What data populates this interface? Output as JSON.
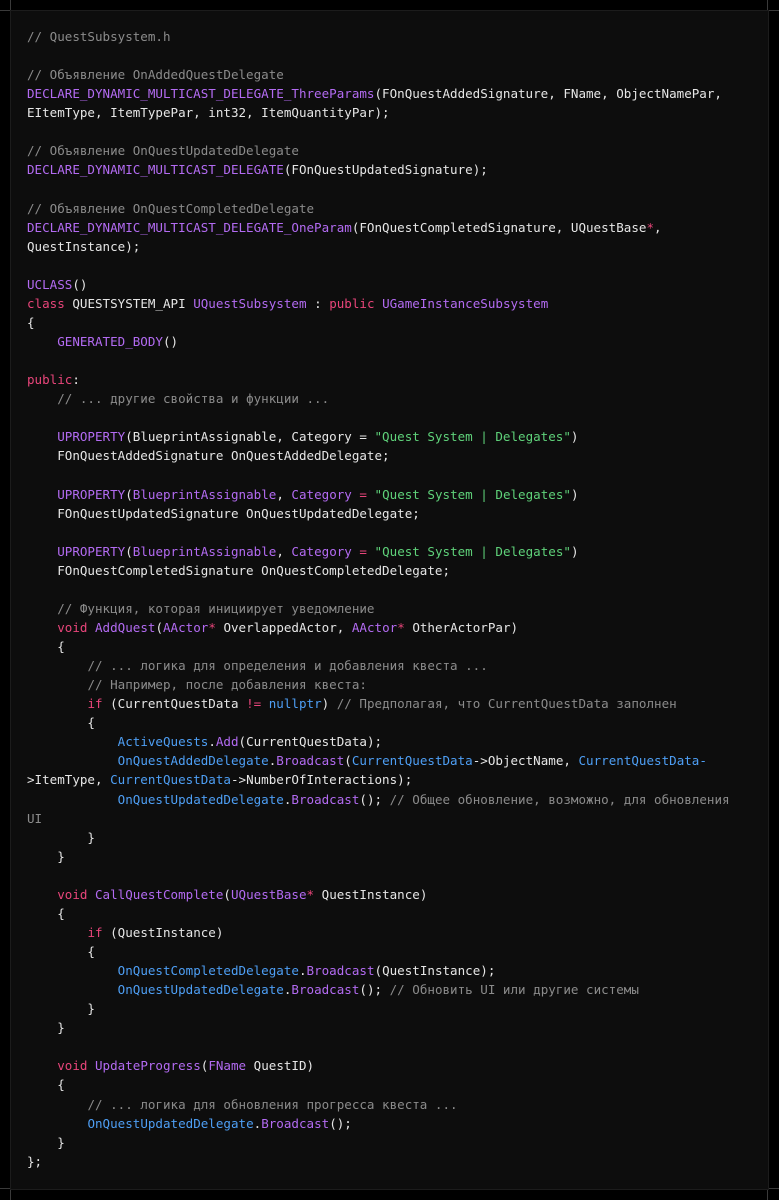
{
  "code_lines": [
    [
      {
        "t": "// QuestSubsystem.h",
        "c": "comment"
      }
    ],
    [],
    [
      {
        "t": "// Объявление OnAddedQuestDelegate",
        "c": "comment"
      }
    ],
    [
      {
        "t": "DECLARE_DYNAMIC_MULTICAST_DELEGATE_ThreeParams",
        "c": "macro"
      },
      {
        "t": "(FOnQuestAddedSignature, FName, ObjectNamePar,",
        "c": "plain"
      }
    ],
    [
      {
        "t": "EItemType, ItemTypePar, int32, ItemQuantityPar);",
        "c": "plain"
      }
    ],
    [],
    [
      {
        "t": "// Объявление OnQuestUpdatedDelegate",
        "c": "comment"
      }
    ],
    [
      {
        "t": "DECLARE_DYNAMIC_MULTICAST_DELEGATE",
        "c": "macro"
      },
      {
        "t": "(FOnQuestUpdatedSignature);",
        "c": "plain"
      }
    ],
    [],
    [
      {
        "t": "// Объявление OnQuestCompletedDelegate",
        "c": "comment"
      }
    ],
    [
      {
        "t": "DECLARE_DYNAMIC_MULTICAST_DELEGATE_OneParam",
        "c": "macro"
      },
      {
        "t": "(FOnQuestCompletedSignature, UQuestBase",
        "c": "plain"
      },
      {
        "t": "*",
        "c": "op"
      },
      {
        "t": ",",
        "c": "plain"
      }
    ],
    [
      {
        "t": "QuestInstance);",
        "c": "plain"
      }
    ],
    [],
    [
      {
        "t": "UCLASS",
        "c": "macro"
      },
      {
        "t": "()",
        "c": "plain"
      }
    ],
    [
      {
        "t": "class",
        "c": "keyword"
      },
      {
        "t": " QUESTSYSTEM_API ",
        "c": "plain"
      },
      {
        "t": "UQuestSubsystem",
        "c": "type"
      },
      {
        "t": " : ",
        "c": "plain"
      },
      {
        "t": "public",
        "c": "keyword"
      },
      {
        "t": " ",
        "c": "plain"
      },
      {
        "t": "UGameInstanceSubsystem",
        "c": "type"
      }
    ],
    [
      {
        "t": "{",
        "c": "plain"
      }
    ],
    [
      {
        "t": "    ",
        "c": "plain"
      },
      {
        "t": "GENERATED_BODY",
        "c": "macro"
      },
      {
        "t": "()",
        "c": "plain"
      }
    ],
    [],
    [
      {
        "t": "public",
        "c": "keyword"
      },
      {
        "t": ":",
        "c": "plain"
      }
    ],
    [
      {
        "t": "    ",
        "c": "plain"
      },
      {
        "t": "// ... другие свойства и функции ...",
        "c": "comment"
      }
    ],
    [],
    [
      {
        "t": "    ",
        "c": "plain"
      },
      {
        "t": "UPROPERTY",
        "c": "macro"
      },
      {
        "t": "(BlueprintAssignable, Category = ",
        "c": "plain"
      },
      {
        "t": "\"Quest System | Delegates\"",
        "c": "string"
      },
      {
        "t": ")",
        "c": "plain"
      }
    ],
    [
      {
        "t": "    FOnQuestAddedSignature OnQuestAddedDelegate;",
        "c": "plain"
      }
    ],
    [],
    [
      {
        "t": "    ",
        "c": "plain"
      },
      {
        "t": "UPROPERTY",
        "c": "macro"
      },
      {
        "t": "(",
        "c": "plain"
      },
      {
        "t": "BlueprintAssignable",
        "c": "type"
      },
      {
        "t": ", ",
        "c": "plain"
      },
      {
        "t": "Category",
        "c": "type"
      },
      {
        "t": " = ",
        "c": "op"
      },
      {
        "t": "\"Quest System | Delegates\"",
        "c": "string"
      },
      {
        "t": ")",
        "c": "plain"
      }
    ],
    [
      {
        "t": "    FOnQuestUpdatedSignature OnQuestUpdatedDelegate;",
        "c": "plain"
      }
    ],
    [],
    [
      {
        "t": "    ",
        "c": "plain"
      },
      {
        "t": "UPROPERTY",
        "c": "macro"
      },
      {
        "t": "(",
        "c": "plain"
      },
      {
        "t": "BlueprintAssignable",
        "c": "type"
      },
      {
        "t": ", ",
        "c": "plain"
      },
      {
        "t": "Category",
        "c": "type"
      },
      {
        "t": " = ",
        "c": "op"
      },
      {
        "t": "\"Quest System | Delegates\"",
        "c": "string"
      },
      {
        "t": ")",
        "c": "plain"
      }
    ],
    [
      {
        "t": "    FOnQuestCompletedSignature OnQuestCompletedDelegate;",
        "c": "plain"
      }
    ],
    [],
    [
      {
        "t": "    ",
        "c": "plain"
      },
      {
        "t": "// Функция, которая инициирует уведомление",
        "c": "comment"
      }
    ],
    [
      {
        "t": "    ",
        "c": "plain"
      },
      {
        "t": "void",
        "c": "keyword"
      },
      {
        "t": " ",
        "c": "plain"
      },
      {
        "t": "AddQuest",
        "c": "type"
      },
      {
        "t": "(",
        "c": "plain"
      },
      {
        "t": "AActor",
        "c": "type"
      },
      {
        "t": "*",
        "c": "op"
      },
      {
        "t": " OverlappedActor, ",
        "c": "plain"
      },
      {
        "t": "AActor",
        "c": "type"
      },
      {
        "t": "*",
        "c": "op"
      },
      {
        "t": " OtherActorPar)",
        "c": "plain"
      }
    ],
    [
      {
        "t": "    {",
        "c": "plain"
      }
    ],
    [
      {
        "t": "        ",
        "c": "plain"
      },
      {
        "t": "// ... логика для определения и добавления квеста ...",
        "c": "comment"
      }
    ],
    [
      {
        "t": "        ",
        "c": "plain"
      },
      {
        "t": "// Например, после добавления квеста:",
        "c": "comment"
      }
    ],
    [
      {
        "t": "        ",
        "c": "plain"
      },
      {
        "t": "if",
        "c": "keyword"
      },
      {
        "t": " (CurrentQuestData ",
        "c": "plain"
      },
      {
        "t": "!=",
        "c": "op"
      },
      {
        "t": " ",
        "c": "plain"
      },
      {
        "t": "nullptr",
        "c": "member"
      },
      {
        "t": ") ",
        "c": "plain"
      },
      {
        "t": "// Предполагая, что CurrentQuestData заполнен",
        "c": "comment"
      }
    ],
    [
      {
        "t": "        {",
        "c": "plain"
      }
    ],
    [
      {
        "t": "            ",
        "c": "plain"
      },
      {
        "t": "ActiveQuests",
        "c": "member"
      },
      {
        "t": ".",
        "c": "plain"
      },
      {
        "t": "Add",
        "c": "type"
      },
      {
        "t": "(CurrentQuestData);",
        "c": "plain"
      }
    ],
    [
      {
        "t": "            ",
        "c": "plain"
      },
      {
        "t": "OnQuestAddedDelegate",
        "c": "member"
      },
      {
        "t": ".",
        "c": "plain"
      },
      {
        "t": "Broadcast",
        "c": "type"
      },
      {
        "t": "(",
        "c": "plain"
      },
      {
        "t": "CurrentQuestData",
        "c": "member"
      },
      {
        "t": "->ObjectName, ",
        "c": "plain"
      },
      {
        "t": "CurrentQuestData-",
        "c": "member"
      }
    ],
    [
      {
        "t": ">ItemType, ",
        "c": "plain"
      },
      {
        "t": "CurrentQuestData",
        "c": "member"
      },
      {
        "t": "->NumberOfInteractions);",
        "c": "plain"
      }
    ],
    [
      {
        "t": "            ",
        "c": "plain"
      },
      {
        "t": "OnQuestUpdatedDelegate",
        "c": "member"
      },
      {
        "t": ".",
        "c": "plain"
      },
      {
        "t": "Broadcast",
        "c": "type"
      },
      {
        "t": "(); ",
        "c": "plain"
      },
      {
        "t": "// Общее обновление, возможно, для обновления",
        "c": "comment"
      }
    ],
    [
      {
        "t": "UI",
        "c": "comment"
      }
    ],
    [
      {
        "t": "        }",
        "c": "plain"
      }
    ],
    [
      {
        "t": "    }",
        "c": "plain"
      }
    ],
    [],
    [
      {
        "t": "    ",
        "c": "plain"
      },
      {
        "t": "void",
        "c": "keyword"
      },
      {
        "t": " ",
        "c": "plain"
      },
      {
        "t": "CallQuestComplete",
        "c": "type"
      },
      {
        "t": "(",
        "c": "plain"
      },
      {
        "t": "UQuestBase",
        "c": "type"
      },
      {
        "t": "*",
        "c": "op"
      },
      {
        "t": " QuestInstance)",
        "c": "plain"
      }
    ],
    [
      {
        "t": "    {",
        "c": "plain"
      }
    ],
    [
      {
        "t": "        ",
        "c": "plain"
      },
      {
        "t": "if",
        "c": "keyword"
      },
      {
        "t": " (QuestInstance)",
        "c": "plain"
      }
    ],
    [
      {
        "t": "        {",
        "c": "plain"
      }
    ],
    [
      {
        "t": "            ",
        "c": "plain"
      },
      {
        "t": "OnQuestCompletedDelegate",
        "c": "member"
      },
      {
        "t": ".",
        "c": "plain"
      },
      {
        "t": "Broadcast",
        "c": "type"
      },
      {
        "t": "(QuestInstance);",
        "c": "plain"
      }
    ],
    [
      {
        "t": "            ",
        "c": "plain"
      },
      {
        "t": "OnQuestUpdatedDelegate",
        "c": "member"
      },
      {
        "t": ".",
        "c": "plain"
      },
      {
        "t": "Broadcast",
        "c": "type"
      },
      {
        "t": "(); ",
        "c": "plain"
      },
      {
        "t": "// Обновить UI или другие системы",
        "c": "comment"
      }
    ],
    [
      {
        "t": "        }",
        "c": "plain"
      }
    ],
    [
      {
        "t": "    }",
        "c": "plain"
      }
    ],
    [],
    [
      {
        "t": "    ",
        "c": "plain"
      },
      {
        "t": "void",
        "c": "keyword"
      },
      {
        "t": " ",
        "c": "plain"
      },
      {
        "t": "UpdateProgress",
        "c": "type"
      },
      {
        "t": "(",
        "c": "plain"
      },
      {
        "t": "FName",
        "c": "type"
      },
      {
        "t": " QuestID)",
        "c": "plain"
      }
    ],
    [
      {
        "t": "    {",
        "c": "plain"
      }
    ],
    [
      {
        "t": "        ",
        "c": "plain"
      },
      {
        "t": "// ... логика для обновления прогресса квеста ...",
        "c": "comment"
      }
    ],
    [
      {
        "t": "        ",
        "c": "plain"
      },
      {
        "t": "OnQuestUpdatedDelegate",
        "c": "member"
      },
      {
        "t": ".",
        "c": "plain"
      },
      {
        "t": "Broadcast",
        "c": "type"
      },
      {
        "t": "();",
        "c": "plain"
      }
    ],
    [
      {
        "t": "    }",
        "c": "plain"
      }
    ],
    [
      {
        "t": "};",
        "c": "plain"
      }
    ]
  ]
}
